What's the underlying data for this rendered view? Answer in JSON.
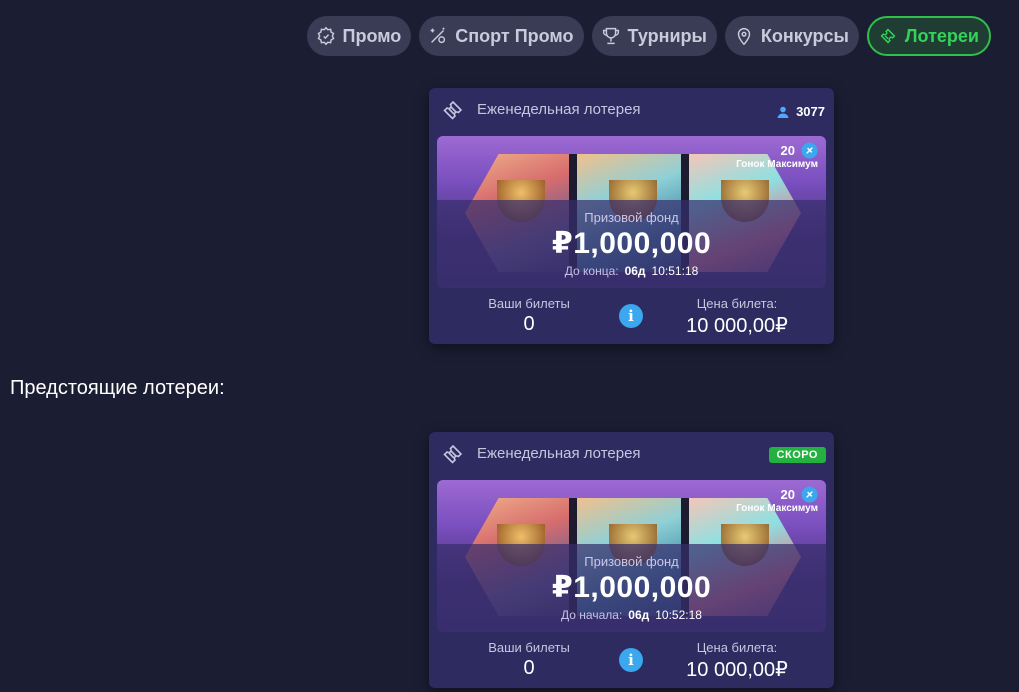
{
  "tabs": [
    {
      "label": "Промо",
      "icon": "gear-badge-icon",
      "active": false
    },
    {
      "label": "Спорт Промо",
      "icon": "sport-badge-icon",
      "active": false
    },
    {
      "label": "Турниры",
      "icon": "trophy-icon",
      "active": false
    },
    {
      "label": "Конкурсы",
      "icon": "location-pin-icon",
      "active": false
    },
    {
      "label": "Лотереи",
      "icon": "ticket-icon",
      "active": true
    }
  ],
  "colors": {
    "background": "#1b1d33",
    "card": "#2d2b5f",
    "active_tab": "#2fbf4a",
    "info": "#3aa7ef"
  },
  "section_upcoming": "Предстоящие лотереи:",
  "lotteries": [
    {
      "title": "Еженедельная лотерея",
      "participants": "3077",
      "winners_count": "20",
      "winners_label": "Гонок Максимум",
      "prize_label": "Призовой фонд",
      "prize": "₽1,000,000",
      "time_label": "До конца:",
      "days": "06д",
      "time": "10:51:18",
      "tickets_label": "Ваши билеты",
      "tickets": "0",
      "price_label": "Цена билета:",
      "price": "10 000,00₽"
    },
    {
      "title": "Еженедельная лотерея",
      "badge": "СКОРО",
      "winners_count": "20",
      "winners_label": "Гонок Максимум",
      "prize_label": "Призовой фонд",
      "prize": "₽1,000,000",
      "time_label": "До начала:",
      "days": "06д",
      "time": "10:52:18",
      "tickets_label": "Ваши билеты",
      "tickets": "0",
      "price_label": "Цена билета:",
      "price": "10 000,00₽"
    }
  ]
}
